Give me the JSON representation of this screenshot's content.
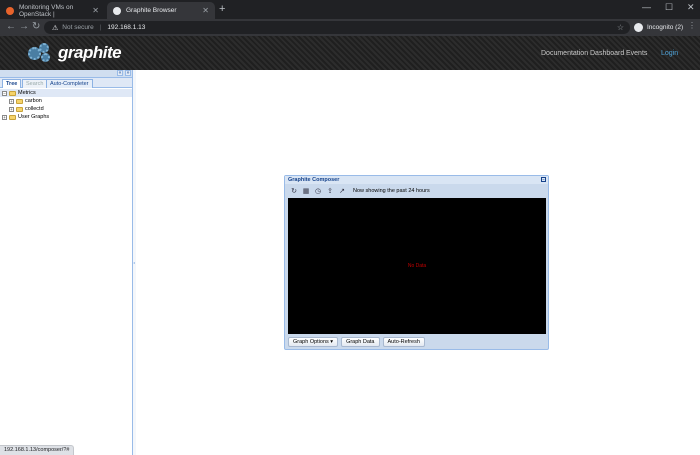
{
  "browser": {
    "tabs": [
      {
        "title": "Monitoring VMs on OpenStack |",
        "active": false,
        "favicon_color": "#e8632b"
      },
      {
        "title": "Graphite Browser",
        "active": true,
        "favicon_color": "#e8eaed"
      }
    ],
    "new_tab": "+",
    "window_controls": [
      "—",
      "☐",
      "✕"
    ],
    "nav": {
      "back": "←",
      "forward": "→",
      "reload": "↻"
    },
    "security": "Not secure",
    "security_icon": "⚠",
    "url": "192.168.1.13",
    "bookmark_icon": "☆",
    "profile": "Incognito (2)",
    "menu_icon": "⋮"
  },
  "header": {
    "logo_text": "graphite",
    "nav": {
      "documentation": "Documentation",
      "dashboard": "Dashboard",
      "events": "Events",
      "login": "Login"
    },
    "login_color": "#4fa3d9"
  },
  "left_panel": {
    "collapse_buttons": [
      "«",
      "»"
    ],
    "tabs": [
      {
        "label": "Tree",
        "state": "active"
      },
      {
        "label": "Search",
        "state": "disabled"
      },
      {
        "label": "Auto-Completer",
        "state": "normal"
      }
    ],
    "tree": {
      "root_label": "Metrics",
      "children": [
        "carbon",
        "collectd"
      ],
      "user_graphs": "User Graphs",
      "expand_minus": "−",
      "expand_plus": "+"
    }
  },
  "composer": {
    "title": "Graphite Composer",
    "toolbar_icons": [
      "refresh-icon",
      "calendar-icon",
      "clock-icon",
      "upload-icon",
      "share-icon"
    ],
    "toolbar_glyphs": [
      "↻",
      "▦",
      "◷",
      "⇪",
      "↗"
    ],
    "status": "Now showing the past 24 hours",
    "no_data": "No Data",
    "buttons": {
      "graph_options": "Graph Options ▾",
      "graph_data": "Graph Data",
      "auto_refresh": "Auto-Refresh"
    }
  },
  "status_bar": {
    "url": "192.168.1.13/composer/?#"
  }
}
